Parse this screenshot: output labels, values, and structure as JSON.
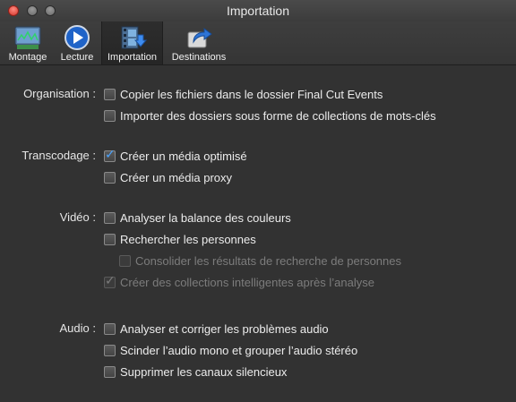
{
  "window": {
    "title": "Importation"
  },
  "toolbar": {
    "items": [
      {
        "label": "Montage",
        "icon": "montage-icon"
      },
      {
        "label": "Lecture",
        "icon": "play-icon"
      },
      {
        "label": "Importation",
        "icon": "import-icon",
        "selected": true
      },
      {
        "label": "Destinations",
        "icon": "share-icon"
      }
    ]
  },
  "groups": {
    "organisation": {
      "label": "Organisation :",
      "options": [
        {
          "label": "Copier les fichiers dans le dossier Final Cut Events",
          "checked": false
        },
        {
          "label": "Importer des dossiers sous forme de collections de mots-clés",
          "checked": false
        }
      ]
    },
    "transcodage": {
      "label": "Transcodage :",
      "options": [
        {
          "label": "Créer un média optimisé",
          "checked": true
        },
        {
          "label": "Créer un média proxy",
          "checked": false
        }
      ]
    },
    "video": {
      "label": "Vidéo :",
      "options": [
        {
          "label": "Analyser la balance des couleurs",
          "checked": false
        },
        {
          "label": "Rechercher les personnes",
          "checked": false
        },
        {
          "label": "Consolider les résultats de recherche de personnes",
          "checked": false,
          "disabled": true
        },
        {
          "label": "Créer des collections intelligentes après l’analyse",
          "checked": true,
          "disabled": true
        }
      ]
    },
    "audio": {
      "label": "Audio :",
      "options": [
        {
          "label": "Analyser et corriger les problèmes audio",
          "checked": false
        },
        {
          "label": "Scinder l’audio mono et grouper l’audio stéréo",
          "checked": false
        },
        {
          "label": "Supprimer les canaux silencieux",
          "checked": false
        }
      ]
    }
  },
  "colors": {
    "background": "#323232",
    "checkmark": "#4aa3ff",
    "disabled_text": "#7c7c7c"
  }
}
